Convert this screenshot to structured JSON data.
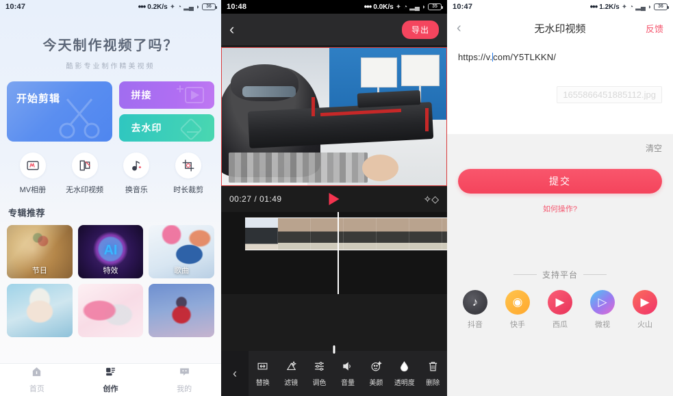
{
  "panel1": {
    "statusbar": {
      "time": "10:47",
      "net_speed": "0.2K/s",
      "battery": "36"
    },
    "hero": {
      "title": "今天制作视频了吗？",
      "subtitle": "酷影专业制作精美视频"
    },
    "cards": {
      "primary": {
        "label": "开始剪辑",
        "icon": "scissors-icon"
      },
      "splice": {
        "label": "拼接",
        "icon": "splice-icon"
      },
      "watermark": {
        "label": "去水印",
        "icon": "eraser-icon"
      }
    },
    "quick_icons": [
      {
        "label": "MV相册",
        "icon": "mv-album-icon"
      },
      {
        "label": "无水印视频",
        "icon": "no-watermark-icon"
      },
      {
        "label": "换音乐",
        "icon": "music-note-icon"
      },
      {
        "label": "时长裁剪",
        "icon": "crop-duration-icon"
      }
    ],
    "section_title": "专辑推荐",
    "albums": [
      {
        "label": "节日"
      },
      {
        "label": "特效"
      },
      {
        "label": "歌曲"
      },
      {
        "label": ""
      },
      {
        "label": ""
      },
      {
        "label": ""
      }
    ],
    "tabbar": [
      {
        "label": "首页",
        "icon": "home-icon",
        "active": false
      },
      {
        "label": "创作",
        "icon": "create-icon",
        "active": true
      },
      {
        "label": "我的",
        "icon": "profile-icon",
        "active": false
      }
    ]
  },
  "panel2": {
    "statusbar": {
      "time": "10:48",
      "net_speed": "0.0K/s",
      "battery": "35"
    },
    "nav": {
      "back_icon": "chevron-left-icon",
      "export_label": "导出"
    },
    "player": {
      "current_time": "00:27",
      "total_time": "01:49",
      "time_display": "00:27 / 01:49",
      "play_icon": "play-icon",
      "effects_icon": "sparkle-icon"
    },
    "tools": [
      {
        "label": "替换",
        "icon": "replace-icon"
      },
      {
        "label": "滤镜",
        "icon": "filter-icon"
      },
      {
        "label": "调色",
        "icon": "color-adjust-icon"
      },
      {
        "label": "音量",
        "icon": "volume-icon"
      },
      {
        "label": "美颜",
        "icon": "beauty-icon"
      },
      {
        "label": "透明度",
        "icon": "opacity-icon"
      },
      {
        "label": "删除",
        "icon": "trash-icon"
      }
    ],
    "tools_back_icon": "chevron-left-icon"
  },
  "panel3": {
    "statusbar": {
      "time": "10:47",
      "net_speed": "1.2K/s",
      "battery": "36"
    },
    "nav": {
      "back_icon": "chevron-left-icon",
      "title": "无水印视频",
      "feedback_label": "反馈"
    },
    "url_field": {
      "value_before_caret": "https://v.",
      "value_after_caret": "com/Y5TLKKN/"
    },
    "file_chip": "1655866451885112.jpg",
    "clear_label": "清空",
    "submit_label": "提交",
    "how_label": "如何操作?",
    "support_label": "支持平台",
    "platforms": [
      {
        "label": "抖音",
        "icon": "douyin-icon"
      },
      {
        "label": "快手",
        "icon": "kuaishou-icon"
      },
      {
        "label": "西瓜",
        "icon": "xigua-icon"
      },
      {
        "label": "微视",
        "icon": "weishi-icon"
      },
      {
        "label": "火山",
        "icon": "huoshan-icon"
      }
    ]
  }
}
